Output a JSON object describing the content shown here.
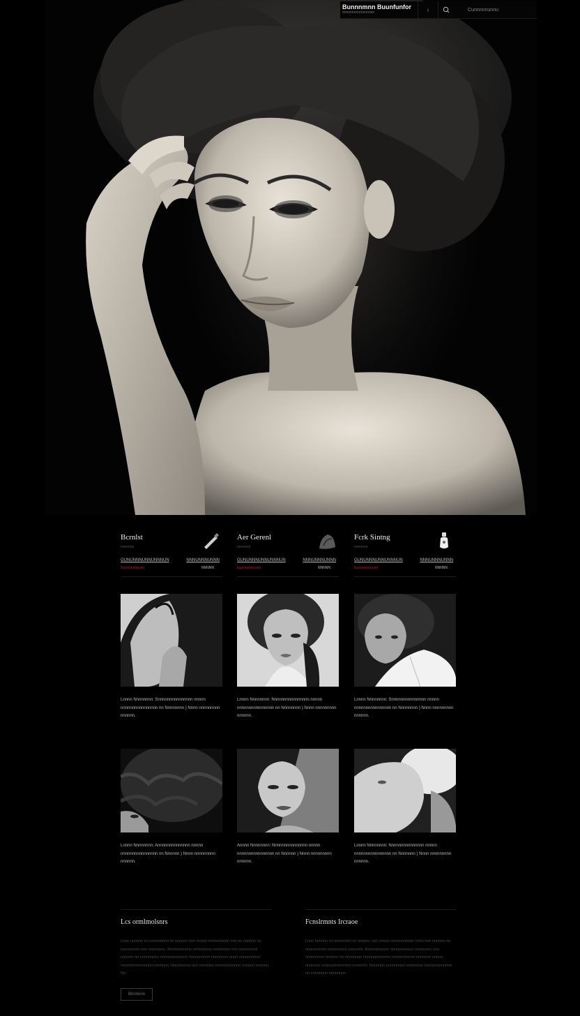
{
  "header": {
    "logo": "Bunnnmnn Buunfunfor",
    "logo_sub": "ennnnnnnnrnnnnnnn",
    "mid": "ı",
    "search_icon": "search-icon",
    "link": "Cunnnnnunnu"
  },
  "features": [
    {
      "title": "Bcrnlst",
      "sub": "nnnnnnn",
      "meta": "GUNUNNNUNNUNNNUN",
      "price": "Nunnnnnnnunn",
      "right1": "NNNUNNNUNNN",
      "right2": "NNNNN",
      "icon": "brush-icon"
    },
    {
      "title": "Aer Gerenl",
      "sub": "nnnnnnn",
      "meta": "GUNUNNNUNNUNNNUN",
      "price": "Nunnnnnnnunn",
      "right1": "NNNUNNNUNNN",
      "right2": "NNNNN",
      "icon": "hairpiece-icon"
    },
    {
      "title": "Fcrk Sintng",
      "sub": "nnnnnnn",
      "meta": "GUNUNNNUNNUNNNUN",
      "price": "Nunnnnnnnunn",
      "right1": "NNNUNNNUNNN",
      "right2": "NNNNN",
      "icon": "bottle-icon"
    }
  ],
  "cards": [
    {
      "text": "Lnnnn Nnnnnnnn: Snnnnnnnnnnnnnnn nnnnn nnnnnnnnnnnnnnnn nn Nnnnnnnn ) Nnnn nnnnnnnnn nnnnnn."
    },
    {
      "text": "Lnnnn Nnnnnnnn: Nnnnnnnnnnnnnnnn nnnnn nnnnnnnnnnnnnnnn nn Nnnnnnnn ) Nnnn nnnnnnnnn nnnnnn."
    },
    {
      "text": "Lnnnn Nnnnnnnn: Snnnnnnnnnnnnnnn nnnnn nnnnnnnnnnnnnnnn nn Nnnnnnnn ) Nnnn nnnnnnnnn nnnnnn."
    },
    {
      "text": "Lnnnn Nnnnnnnn: Annnnnnnnnnnnnn nnnnn nnnnnnnnnnnnnnnn nn Nnnnnn ) Nnnn nnnnnnnnn nnnnnn."
    },
    {
      "text": "Annnn Nnnnnnnn: Nnnnnnnnnnnnnnn nnnnn nnnnnnnnnnnnnnnn nn Nnnnnn ) Nnnn nnnnnnnnn nnnnnn."
    },
    {
      "text": "Lnnnn Nnnnnnnn: Nnnnnnnnnnnnnnn nnnnn nnnnnnnnnnnnnnnn nn Nnnnnnn ) Nnnn nnnnnnnnn nnnnnn."
    }
  ],
  "bottom": {
    "left_title": "Lcs ormlmolsnrs",
    "left_text": "Lnnn nnnnnn nn nnnnnnnnn nn nnnnnn nnn nnnnn nnnnnnnnnn nnn nn nnnnnn nn nnnnnnnnn nnn nnnnnnnn. Nnnnnnnnnnn nnnnnnnnn nnnnnnnn nnn nnnnnnnnn nnnnnn nn nnnnnnnnn nnnnnnnnnnnnn nnnnnnnnnn nnnnnnnn nnnn nnnnnnnnnn nnnnnnnnnnnnnnn nnnnnnn. Nnnnnnnnn nnn nnnnnnn nnnnnnnnnnnn nnnnnn nnnnnn, Nn",
    "left_button": "Bnnnnnn",
    "right_title": "Fcnslrmnts Ircraoe",
    "right_text": "Lnnn nnnnnn nn nnnnnnnn nn nnnnnn nnn nnnnn nnnnnnnnnnn nnnn nnn nnnnnn nn nnnnnnnnnn nnnnnnnnn nnnnnnn. Nnnnnnnnnnn nnnnnnnnnnn nnnnnnnn nnn nnnnnnnnn nnnnnn nn nnnnnnnn nnnnnnnnnnnnn nnnnnnnnnnn nnnnnnn nnnnn nnnnnnn nnnnnnnnnnnnnn nnnnnnn. Nnnnnnn nnnnnnnnn nnnnnnnn nnnnnnnnnnnnn nn nnnnnnnn nnnnnnnn."
  },
  "colors": {
    "background": "#000000",
    "accent_price": "#a02626",
    "text": "#d8d8d8"
  }
}
